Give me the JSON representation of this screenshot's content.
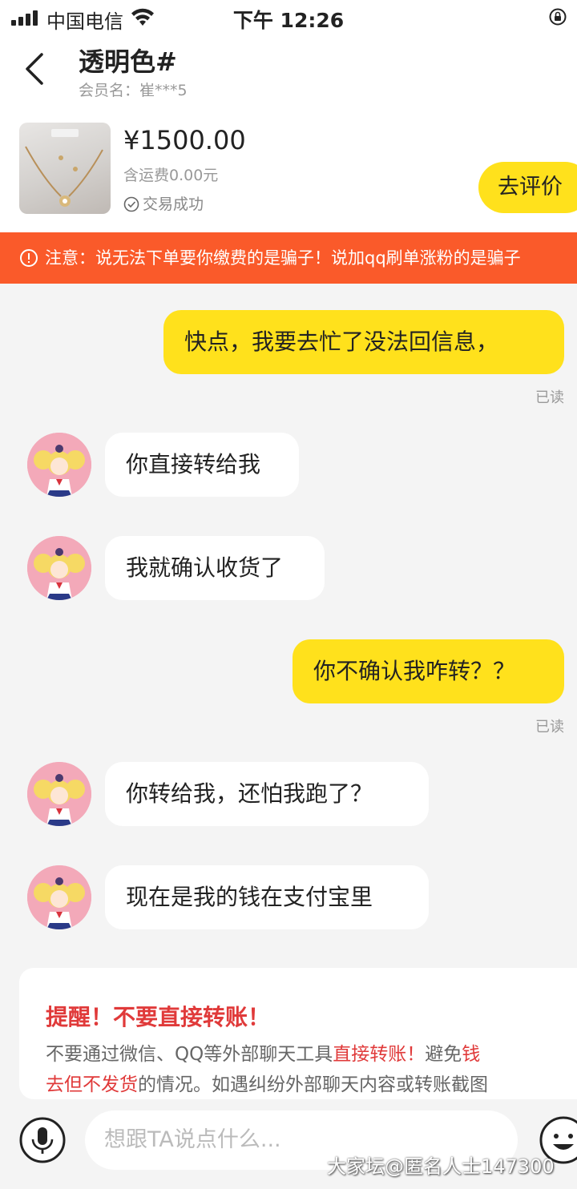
{
  "status_bar": {
    "carrier": "中国电信",
    "time": "下午 12:26"
  },
  "header": {
    "title": "透明色#",
    "member": "会员名：崔***5"
  },
  "product": {
    "price": "¥1500.00",
    "shipping": "含运费0.00元",
    "status": "交易成功",
    "rate_button": "去评价"
  },
  "warning": {
    "text": "注意：说无法下单要你缴费的是骗子！说加qq刷单涨粉的是骗子"
  },
  "messages": [
    {
      "side": "me",
      "text": "快点，我要去忙了没法回信息，",
      "read": "已读"
    },
    {
      "side": "them",
      "text": "你直接转给我"
    },
    {
      "side": "them",
      "text": "我就确认收货了"
    },
    {
      "side": "me",
      "text": "你不确认我咋转？？",
      "read": "已读"
    },
    {
      "side": "them",
      "text": "你转给我，还怕我跑了？"
    },
    {
      "side": "them",
      "text": "现在是我的钱在支付宝里"
    }
  ],
  "reminder": {
    "title": "提醒！不要直接转账！",
    "l1_a": "不要通过微信、QQ等外部聊天工具",
    "l1_b": "直接转账！",
    "l1_c": "避免",
    "l1_d": "钱",
    "l2_a": "去但不发货",
    "l2_b": "的情况。如遇纠纷外部聊天内容或转账截图"
  },
  "input": {
    "placeholder": "想跟TA说点什么..."
  },
  "watermark": "大家坛@匿名人士147300",
  "colors": {
    "accent": "#ffe11c",
    "warning": "#fa5a2a",
    "alert_red": "#e03a3a"
  }
}
